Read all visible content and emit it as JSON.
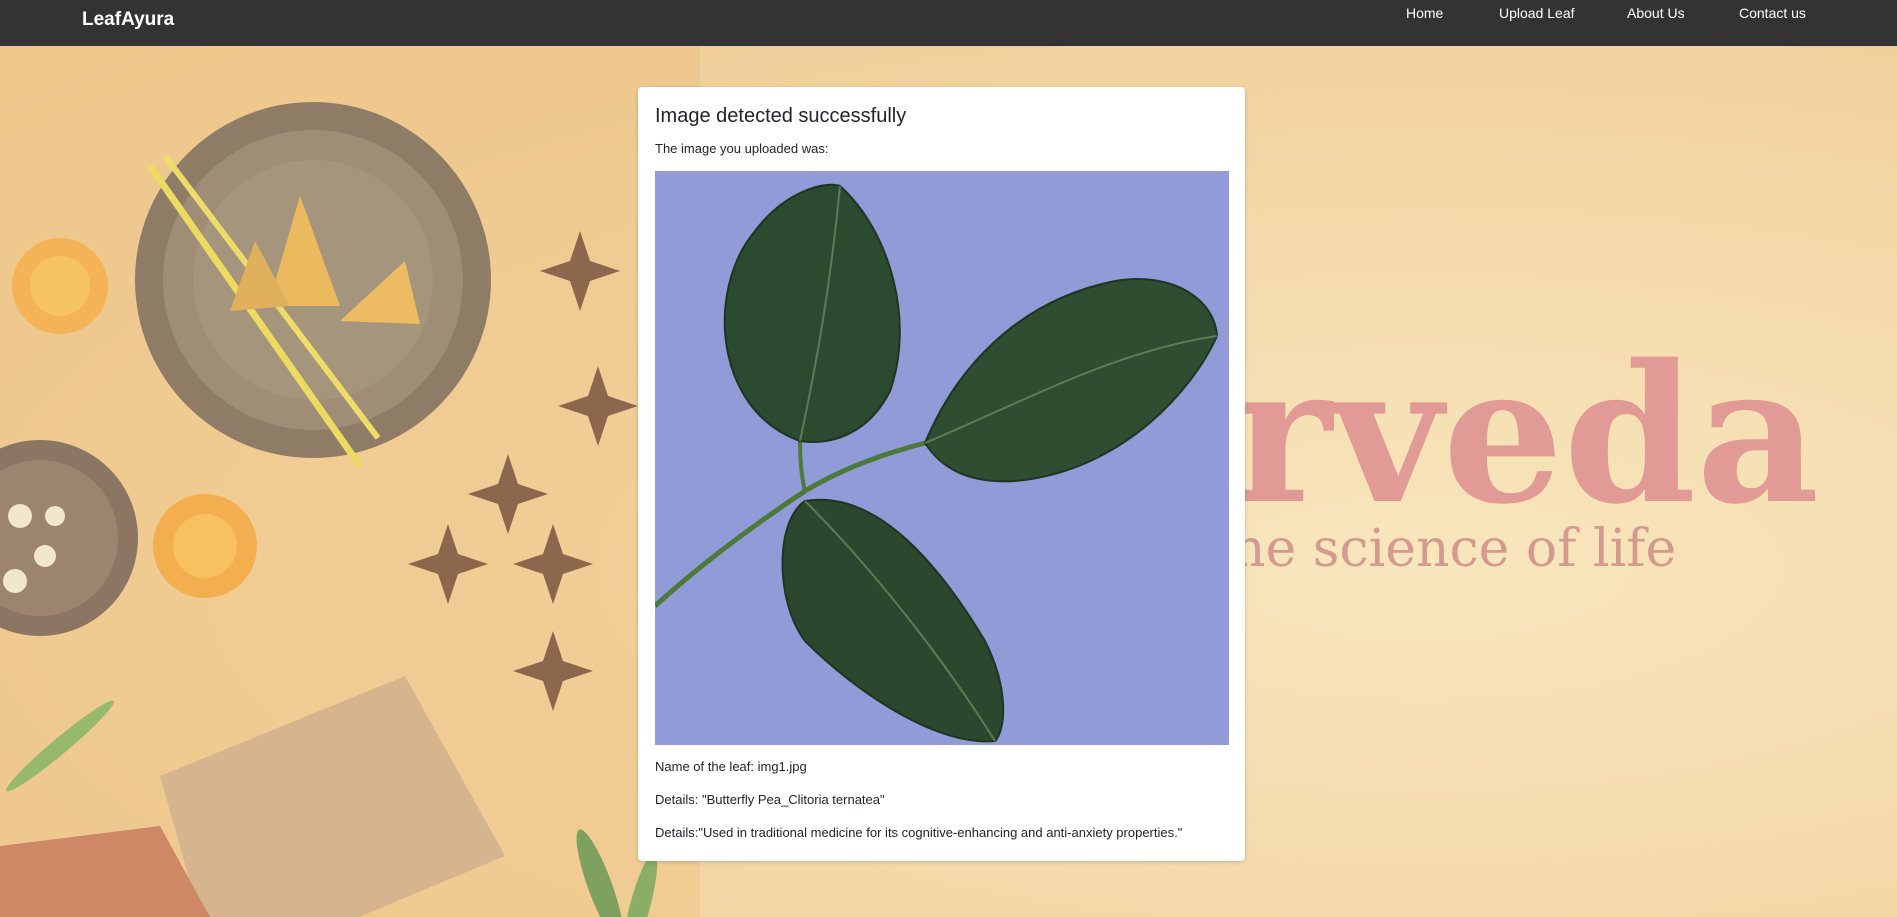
{
  "navbar": {
    "brand": "LeafAyura",
    "links": [
      {
        "label": "Home"
      },
      {
        "label": "Upload Leaf"
      },
      {
        "label": "About Us"
      },
      {
        "label": "Contact us"
      }
    ]
  },
  "background": {
    "title_fragment": "rveda",
    "subtitle_fragment": "ne science of life"
  },
  "card": {
    "title": "Image detected successfully",
    "subtitle": "The image you uploaded was:",
    "leaf_name": "Name of the leaf: img1.jpg",
    "details_1": "Details: \"Butterfly Pea_Clitoria ternatea\"",
    "details_2": "Details:\"Used in traditional medicine for its cognitive-enhancing and anti-anxiety properties.\""
  },
  "colors": {
    "navbar_bg": "#333333",
    "image_bg": "#8b97d6",
    "leaf_green": "#2c4a2f",
    "logo_pink": "#d98080"
  }
}
